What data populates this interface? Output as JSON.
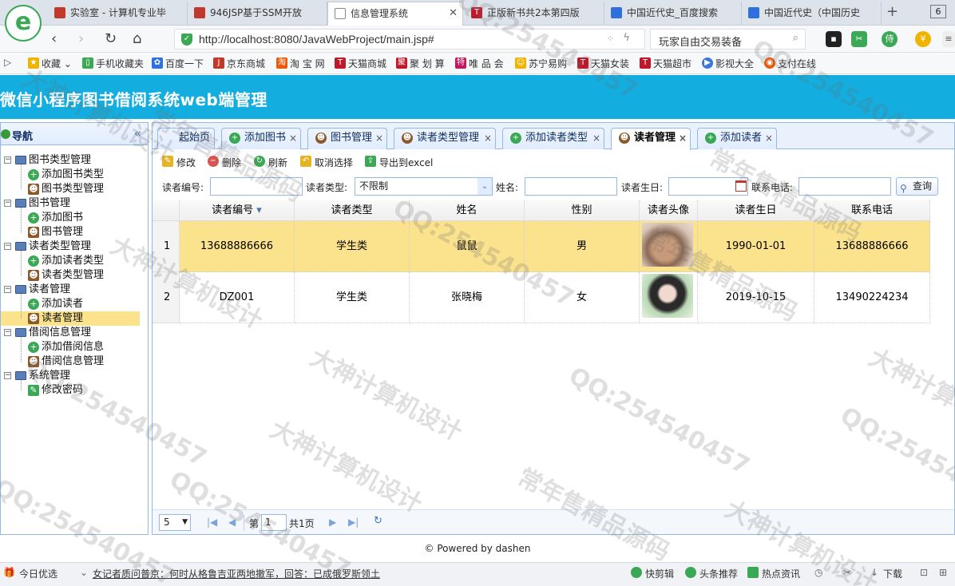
{
  "browser": {
    "tabs": [
      {
        "label": "实验室 - 计算机专业毕",
        "color": "#c0392b"
      },
      {
        "label": "946JSP基于SSM开放",
        "color": "#c0392b"
      },
      {
        "label": "信息管理系统",
        "color": "#888888",
        "active": true
      },
      {
        "label": "正版新书共2本第四版",
        "color": "#c0392b"
      },
      {
        "label": "中国近代史_百度搜索",
        "color": "#2f6fde"
      },
      {
        "label": "中国近代史（中国历史",
        "color": "#2f6fde"
      }
    ],
    "tab_count": "6",
    "url": "http://localhost:8080/JavaWebProject/main.jsp#",
    "search_text": "玩家自由交易装备",
    "bookmarks": [
      {
        "label": "收藏",
        "icon": "star-icon",
        "color": "#f0b400"
      },
      {
        "label": "手机收藏夹",
        "icon": "phone-icon",
        "color": "#3aa854"
      },
      {
        "label": "百度一下",
        "icon": "paw-icon",
        "color": "#2f6fde"
      },
      {
        "label": "京东商城",
        "icon": "jd-icon",
        "color": "#c0392b"
      },
      {
        "label": "淘 宝 网",
        "icon": "taobao-icon",
        "color": "#e8590c"
      },
      {
        "label": "天猫商城",
        "icon": "tmall-icon",
        "color": "#c0182b"
      },
      {
        "label": "聚 划 算",
        "icon": "ju-icon",
        "color": "#c0182b"
      },
      {
        "label": "唯 品 会",
        "icon": "vip-icon",
        "color": "#c2185b"
      },
      {
        "label": "苏宁易购",
        "icon": "suning-icon",
        "color": "#f0b400"
      },
      {
        "label": "天猫女装",
        "icon": "tmall-icon",
        "color": "#c0182b"
      },
      {
        "label": "天猫超市",
        "icon": "tmall-icon",
        "color": "#c0182b"
      },
      {
        "label": "影视大全",
        "icon": "play-icon",
        "color": "#3c78d8"
      },
      {
        "label": "支付在线",
        "icon": "pay-icon",
        "color": "#e8590c"
      }
    ]
  },
  "app": {
    "title": "微信小程序图书借阅系统web端管理",
    "header_color": "#13aedf"
  },
  "sidebar": {
    "title": "导航",
    "groups": [
      {
        "label": "图书类型管理",
        "children": [
          {
            "label": "添加图书类型",
            "icon": "add-icon"
          },
          {
            "label": "图书类型管理",
            "icon": "user-icon"
          }
        ]
      },
      {
        "label": "图书管理",
        "children": [
          {
            "label": "添加图书",
            "icon": "add-icon"
          },
          {
            "label": "图书管理",
            "icon": "user-icon"
          }
        ]
      },
      {
        "label": "读者类型管理",
        "children": [
          {
            "label": "添加读者类型",
            "icon": "add-icon"
          },
          {
            "label": "读者类型管理",
            "icon": "user-icon"
          }
        ]
      },
      {
        "label": "读者管理",
        "children": [
          {
            "label": "添加读者",
            "icon": "add-icon"
          },
          {
            "label": "读者管理",
            "icon": "user-icon",
            "selected": true
          }
        ]
      },
      {
        "label": "借阅信息管理",
        "children": [
          {
            "label": "添加借阅信息",
            "icon": "add-icon"
          },
          {
            "label": "借阅信息管理",
            "icon": "user-icon"
          }
        ]
      },
      {
        "label": "系统管理",
        "children": [
          {
            "label": "修改密码",
            "icon": "pencil-icon"
          }
        ]
      }
    ]
  },
  "panel_tabs": [
    {
      "label": "起始页",
      "icon": "",
      "closable": false
    },
    {
      "label": "添加图书",
      "icon": "add-icon",
      "closable": true
    },
    {
      "label": "图书管理",
      "icon": "user-icon",
      "closable": true
    },
    {
      "label": "读者类型管理",
      "icon": "user-icon",
      "closable": true
    },
    {
      "label": "添加读者类型",
      "icon": "add-icon",
      "closable": true
    },
    {
      "label": "读者管理",
      "icon": "user-icon",
      "closable": true,
      "active": true
    },
    {
      "label": "添加读者",
      "icon": "add-icon",
      "closable": true
    }
  ],
  "toolbar": {
    "edit": "修改",
    "delete": "删除",
    "refresh": "刷新",
    "cancel_select": "取消选择",
    "export": "导出到excel"
  },
  "filters": {
    "reader_no_label": "读者编号:",
    "reader_no_value": "",
    "reader_type_label": "读者类型:",
    "reader_type_value": "不限制",
    "name_label": "姓名:",
    "name_value": "",
    "birthday_label": "读者生日:",
    "birthday_value": "",
    "phone_label": "联系电话:",
    "phone_value": "",
    "query_button": "查询"
  },
  "grid": {
    "columns": [
      "读者编号",
      "读者类型",
      "姓名",
      "性别",
      "读者头像",
      "读者生日",
      "联系电话"
    ],
    "rows": [
      {
        "num": "1",
        "reader_no": "13688886666",
        "type": "学生类",
        "name": "鼠鼠",
        "gender": "男",
        "avatar": "hamster-photo",
        "birthday": "1990-01-01",
        "phone": "13688886666",
        "selected": true
      },
      {
        "num": "2",
        "reader_no": "DZ001",
        "type": "学生类",
        "name": "张晓梅",
        "gender": "女",
        "avatar": "girl-photo",
        "birthday": "2019-10-15",
        "phone": "13490224234",
        "selected": false
      }
    ]
  },
  "pager": {
    "page_size": "5",
    "page_label": "第",
    "page_value": "1",
    "total": "共1页"
  },
  "footer": "© Powered by dashen",
  "statusbar": {
    "left": "今日优选",
    "news": "女记者质问普京：何时从格鲁吉亚两地撤军，回答：已成俄罗斯领土",
    "right_items": [
      "快剪辑",
      "头条推荐",
      "热点资讯",
      "下载"
    ]
  },
  "watermarks": [
    "QQ:254540457",
    "常年售精品源码",
    "大神计算机设计"
  ]
}
